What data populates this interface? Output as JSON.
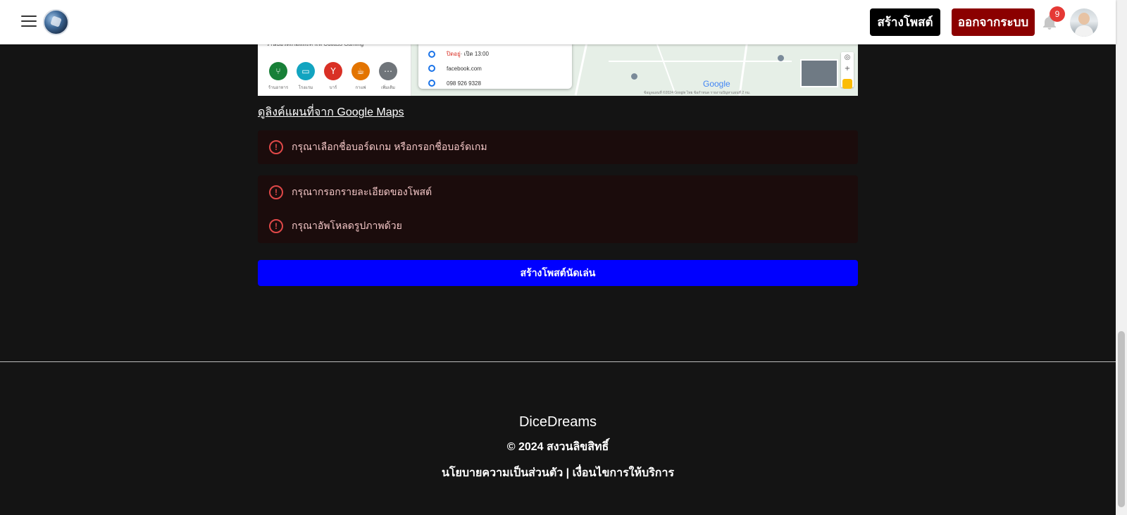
{
  "header": {
    "create_post_label": "สร้างโพสต์",
    "logout_label": "ออกจากระบบ",
    "notification_count": "9"
  },
  "map": {
    "place_name": "ร้านบอร์ดเกมและคาเฟ่ Cutlass Gaming",
    "categories": [
      {
        "label": "ร้านอาหาร",
        "color": "#188038"
      },
      {
        "label": "โรงแรม",
        "color": "#12a4c0"
      },
      {
        "label": "บาร์",
        "color": "#d93025"
      },
      {
        "label": "กาแฟ",
        "color": "#e37400"
      },
      {
        "label": "เพิ่มเติม",
        "color": "#70757a"
      }
    ],
    "hours_status": "ปิดอยู่",
    "hours_text": " · เปิด 13:00",
    "website": "facebook.com",
    "phone": "098 926 9328",
    "google_logo": "Google",
    "footer_text": "ข้อมูลแผนที่ ©2024 Google   ไทย   ข้อกำหนด   รายงานปัญหาแผนที่   2 กม."
  },
  "maps_link_label": "ดูลิงค์แผนที่จาก Google Maps",
  "errors": {
    "boardgame": "กรุณาเลือกชื่อบอร์ดเกม หรือกรอกชื่อบอร์ดเกม",
    "details": "กรุณากรอกรายละเอียดของโพสต์",
    "image": "กรุณาอัพโหลดรูปภาพด้วย"
  },
  "submit_label": "สร้างโพสต์นัดเล่น",
  "footer": {
    "brand": "DiceDreams",
    "copyright": "© 2024 สงวนลิขสิทธิ์",
    "privacy": "นโยบายความเป็นส่วนตัว",
    "separator": " | ",
    "terms": "เงื่อนไขการให้บริการ"
  },
  "colors": {
    "background": "#141414",
    "submit": "#0000ff",
    "logout": "#8b0000",
    "error_bg": "#1b0c0c",
    "error_icon": "#e04848"
  }
}
